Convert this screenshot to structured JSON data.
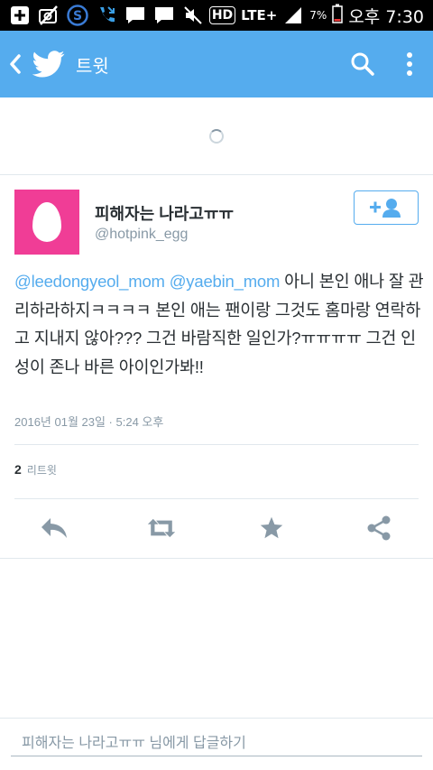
{
  "status_bar": {
    "icons": [
      "plus-box-icon",
      "no-camera-icon",
      "s-app-icon",
      "missed-call-icon",
      "message-icon",
      "message-icon",
      "mute-icon"
    ],
    "hd": "HD",
    "network": "LTE+",
    "battery": "7%",
    "time": "오후 7:30"
  },
  "app_bar": {
    "title": "트윗",
    "back_icon": "back-arrow-icon",
    "logo_icon": "twitter-bird-icon",
    "search_icon": "search-icon",
    "menu_icon": "overflow-menu-icon",
    "color": "#55acee"
  },
  "tweet": {
    "name": "피해자는 나라고ㅠㅠ",
    "handle": "@hotpink_egg",
    "avatar_color": "#f03d96",
    "mention1": "@leedongyeol_mom",
    "mention2": "@yaebin_mom",
    "body": "아니 본인 애나 잘 관리하라하지ㅋㅋㅋㅋ 본인 애는 팬이랑 그것도 홈마랑 연락하고 지내지 않아??? 그건 바람직한 일인가?ㅠㅠㅠㅠ 그건 인성이 존나 바른 아이인가봐!!",
    "date": "2016년 01월 23일 · 5:24 오후",
    "retweet_count": "2",
    "retweet_label": "리트윗"
  },
  "actions": {
    "reply_icon": "reply-icon",
    "retweet_icon": "retweet-icon",
    "favorite_icon": "star-icon",
    "share_icon": "share-icon"
  },
  "reply_bar": {
    "placeholder": "피해자는 나라고ㅠㅠ 님에게 답글하기"
  }
}
